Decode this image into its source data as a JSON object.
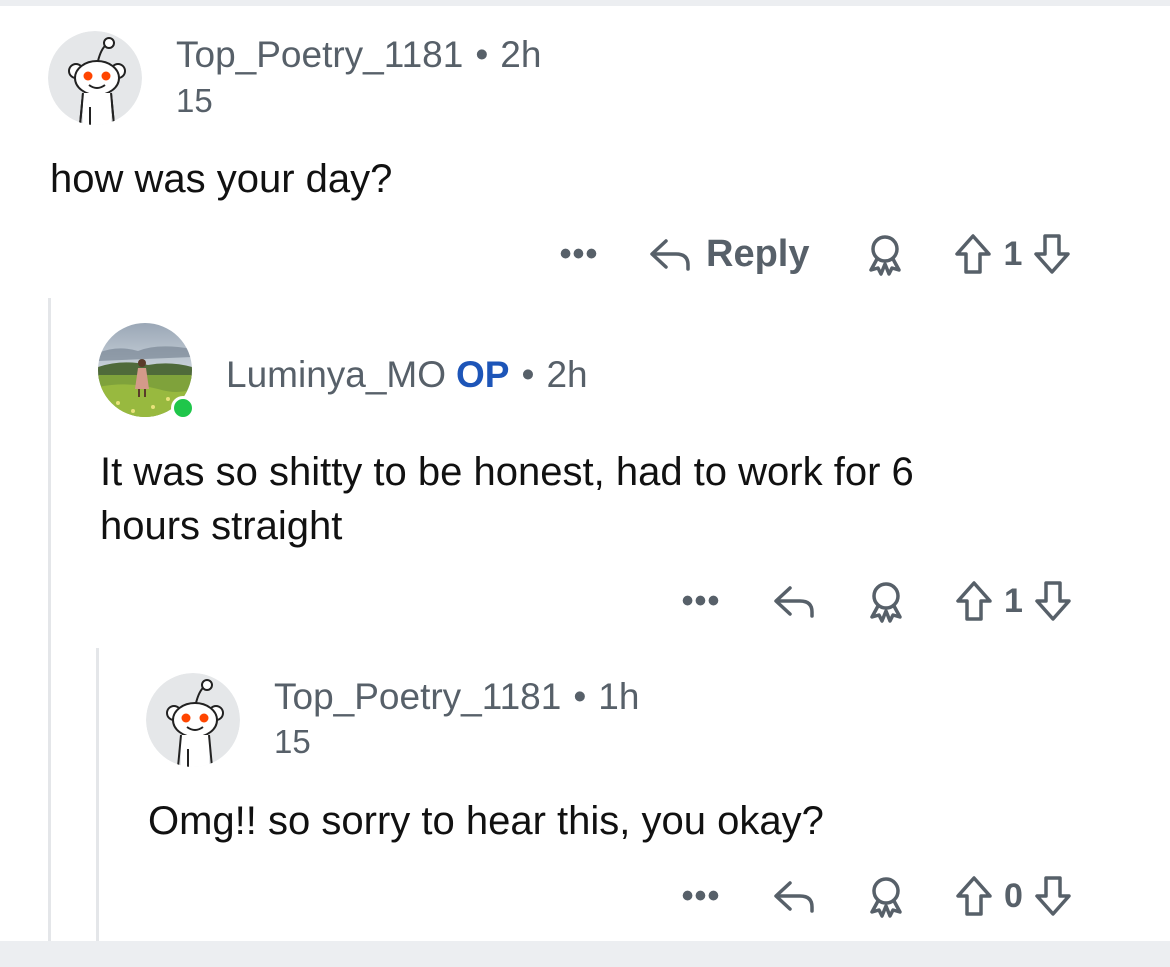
{
  "comments": [
    {
      "author": "Top_Poetry_1181",
      "separator": "•",
      "time": "2h",
      "flair": "15",
      "body": "how was your day?",
      "actions": {
        "more": "•••",
        "reply_label": "Reply",
        "score": "1"
      },
      "avatar_icon": "reddit-snoo-icon"
    },
    {
      "author": "Luminya_MO",
      "op_badge": "OP",
      "separator": "•",
      "time": "2h",
      "body_line1": "It was so shitty to be honest, had to work for 6",
      "body_line2": "hours straight",
      "actions": {
        "more": "•••",
        "score": "1"
      },
      "avatar_icon": "photo-avatar",
      "online": true
    },
    {
      "author": "Top_Poetry_1181",
      "separator": "•",
      "time": "1h",
      "flair": "15",
      "body": "Omg!! so sorry to hear this, you okay?",
      "actions": {
        "more": "•••",
        "score": "0"
      },
      "avatar_icon": "reddit-snoo-icon"
    }
  ],
  "colors": {
    "meta_gray": "#576069",
    "op_blue": "#1d55b8",
    "online_green": "#1fc64a",
    "snoo_orange": "#ff4500",
    "thread_line": "#e4e6e9"
  }
}
